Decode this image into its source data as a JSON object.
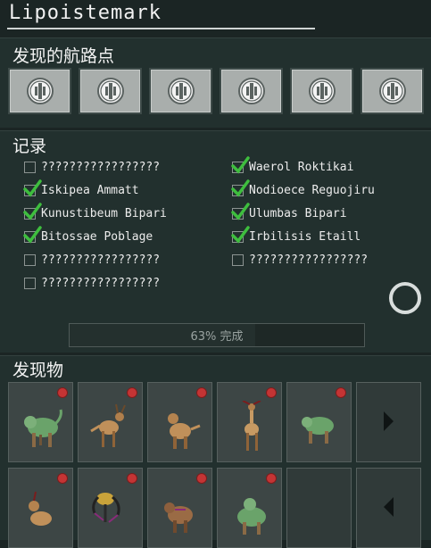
{
  "title": "Lipoistemark",
  "waypoints": {
    "title": "发现的航路点",
    "count": 6
  },
  "records": {
    "title": "记录",
    "left": [
      {
        "label": "?????????????????",
        "checked": false
      },
      {
        "label": "Iskipea Ammatt",
        "checked": true
      },
      {
        "label": "Kunustibeum Bipari",
        "checked": true
      },
      {
        "label": "Bitossae Poblage",
        "checked": true
      },
      {
        "label": "?????????????????",
        "checked": false
      },
      {
        "label": "?????????????????",
        "checked": false
      }
    ],
    "right": [
      {
        "label": "Waerol Roktikai",
        "checked": true
      },
      {
        "label": "Nodioece Reguojiru",
        "checked": true
      },
      {
        "label": "Ulumbas Bipari",
        "checked": true
      },
      {
        "label": "Irbilisis Etaill",
        "checked": true
      },
      {
        "label": "?????????????????",
        "checked": false
      }
    ]
  },
  "progress": {
    "label": "63% 完成",
    "value": 63
  },
  "finds": {
    "title": "发现物",
    "colors": {
      "alert": "#c43434",
      "green_creature": "#6aa36a",
      "tan_creature": "#c0905a"
    }
  }
}
